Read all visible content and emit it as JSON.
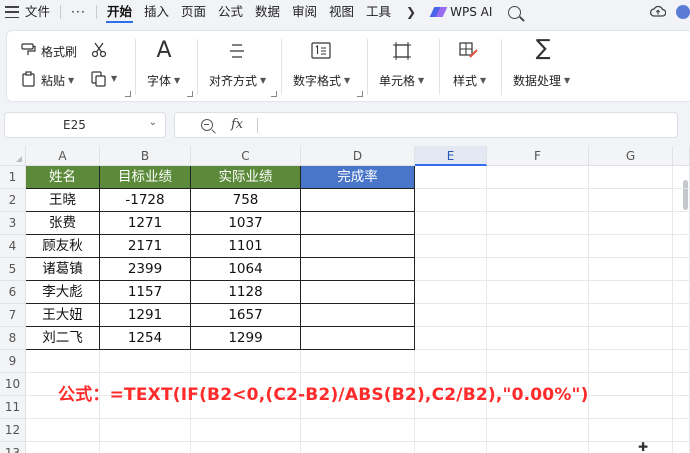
{
  "menubar": {
    "file": "文件",
    "more": "···",
    "tabs": [
      "开始",
      "插入",
      "页面",
      "公式",
      "数据",
      "审阅",
      "视图",
      "工具"
    ],
    "active_tab": "开始",
    "wps_ai": "WPS AI"
  },
  "ribbon": {
    "format_painter": "格式刷",
    "paste": "粘贴",
    "font": "字体",
    "align": "对齐方式",
    "number_format": "数字格式",
    "cell": "单元格",
    "style": "样式",
    "data_process": "数据处理"
  },
  "formula_bar": {
    "name_box": "E25",
    "fx": "fx",
    "content": ""
  },
  "sheet": {
    "columns": [
      "A",
      "B",
      "C",
      "D",
      "E",
      "F",
      "G"
    ],
    "selected_column": "E",
    "rows": [
      "1",
      "2",
      "3",
      "4",
      "5",
      "6",
      "7",
      "8",
      "9",
      "10",
      "11",
      "12",
      "13"
    ],
    "headers": [
      "姓名",
      "目标业绩",
      "实际业绩",
      "完成率"
    ],
    "header_colors": {
      "green": "#5b8a3a",
      "blue": "#4a76c9"
    },
    "data": [
      [
        "王晓",
        "-1728",
        "758",
        ""
      ],
      [
        "张费",
        "1271",
        "1037",
        ""
      ],
      [
        "顾友秋",
        "2171",
        "1101",
        ""
      ],
      [
        "诸葛镇",
        "2399",
        "1064",
        ""
      ],
      [
        "李大彪",
        "1157",
        "1128",
        ""
      ],
      [
        "王大妞",
        "1291",
        "1657",
        ""
      ],
      [
        "刘二飞",
        "1254",
        "1299",
        ""
      ]
    ],
    "note": "公式：=TEXT(IF(B2<0,(C2-B2)/ABS(B2),C2/B2),\"0.00%\")"
  }
}
